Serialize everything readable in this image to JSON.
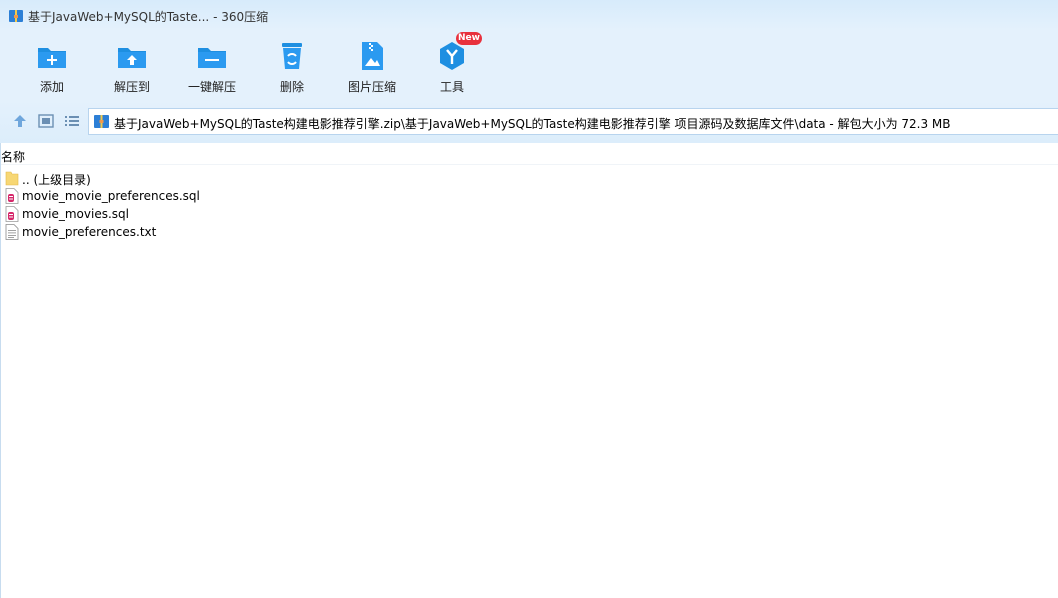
{
  "window": {
    "title": "基于JavaWeb+MySQL的Taste... - 360压缩"
  },
  "toolbar": {
    "items": [
      {
        "label": "添加",
        "icon": "add-folder-icon"
      },
      {
        "label": "解压到",
        "icon": "extract-to-icon"
      },
      {
        "label": "一键解压",
        "icon": "one-click-extract-icon"
      },
      {
        "label": "删除",
        "icon": "recycle-bin-icon"
      },
      {
        "label": "图片压缩",
        "icon": "image-compress-icon"
      },
      {
        "label": "工具",
        "icon": "tools-icon",
        "badge": "New"
      }
    ]
  },
  "nav": {
    "buttons": [
      "up-arrow-icon",
      "thumbnail-view-icon",
      "list-view-icon"
    ]
  },
  "address": {
    "path": "基于JavaWeb+MySQL的Taste构建电影推荐引擎.zip\\基于JavaWeb+MySQL的Taste构建电影推荐引擎 项目源码及数据库文件\\data - 解包大小为 72.3 MB"
  },
  "list": {
    "column_name": "名称",
    "rows": [
      {
        "name": ".. (上级目录)",
        "icon": "folder-icon"
      },
      {
        "name": "movie_movie_preferences.sql",
        "icon": "sql-file-icon"
      },
      {
        "name": "movie_movies.sql",
        "icon": "sql-file-icon"
      },
      {
        "name": "movie_preferences.txt",
        "icon": "text-file-icon"
      }
    ]
  },
  "colors": {
    "accent": "#1e8fe1",
    "toolbar_bg": "#e4f1fc",
    "badge": "#e8313d"
  }
}
